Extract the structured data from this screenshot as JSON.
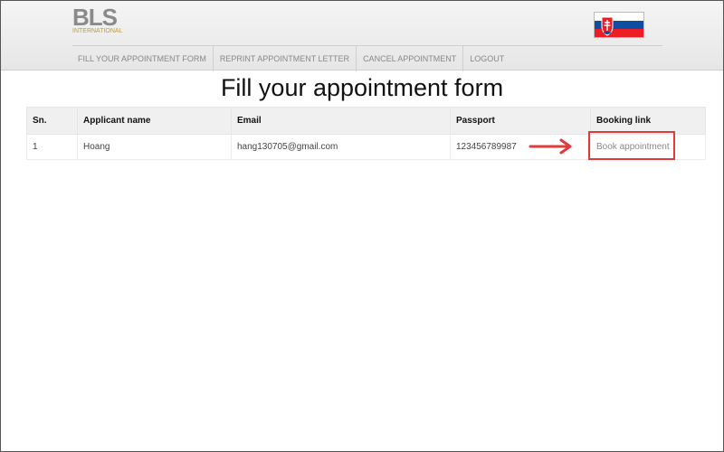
{
  "header": {
    "logo": {
      "mark": "BLS",
      "sub": "INTERNATIONAL"
    },
    "flag": {
      "icon": "slovakia-flag-icon",
      "colors": [
        "#ffffff",
        "#0b4ea2",
        "#ee1c25"
      ]
    }
  },
  "nav": {
    "items": [
      {
        "label": "FILL YOUR APPOINTMENT FORM"
      },
      {
        "label": "REPRINT APPOINTMENT LETTER"
      },
      {
        "label": "CANCEL APPOINTMENT"
      },
      {
        "label": "LOGOUT"
      }
    ]
  },
  "page": {
    "title": "Fill your appointment form"
  },
  "table": {
    "headers": [
      "Sn.",
      "Applicant name",
      "Email",
      "Passport",
      "Booking link"
    ],
    "rows": [
      {
        "sn": "1",
        "name": "Hoang",
        "email": "hang130705@gmail.com",
        "passport": "123456789987",
        "link": "Book appointment"
      }
    ]
  },
  "annotation": {
    "color": "#e03a3a",
    "icon": "arrow-right-icon"
  }
}
